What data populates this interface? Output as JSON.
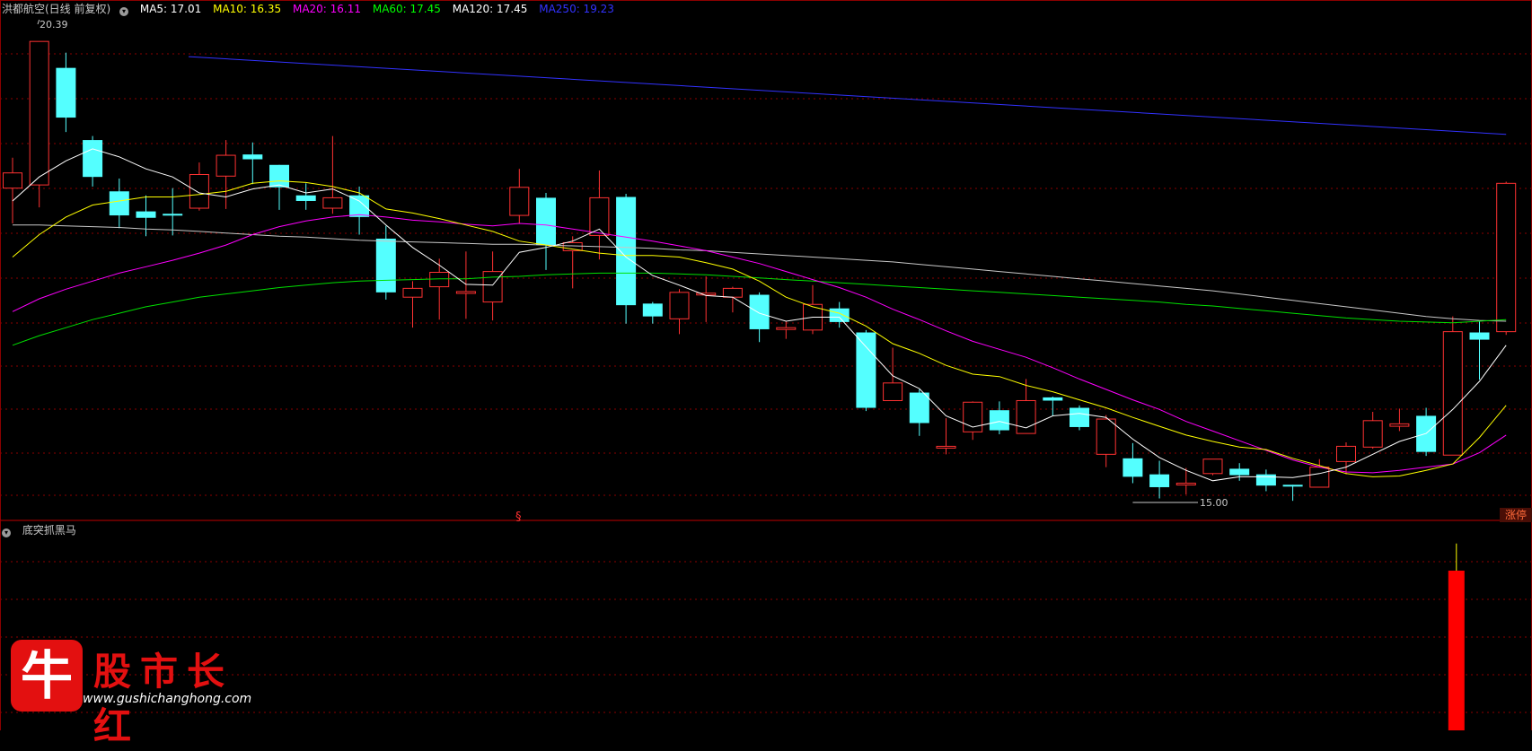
{
  "header": {
    "stock_name": "洪都航空(日线 前复权)",
    "indicators": [
      {
        "label": "MA5: 17.01",
        "color": "#ffffff"
      },
      {
        "label": "MA10: 16.35",
        "color": "#ffff00"
      },
      {
        "label": "MA20: 16.11",
        "color": "#ff00ff"
      },
      {
        "label": "MA60: 17.45",
        "color": "#00ff00"
      },
      {
        "label": "MA120: 17.45",
        "color": "#ffffff"
      },
      {
        "label": "MA250: 19.23",
        "color": "#3232ff"
      }
    ]
  },
  "annotations": {
    "high_label": "20.39",
    "low_label": "15.00",
    "section_mark": "§",
    "zt_label": "涨停"
  },
  "sub_panel": {
    "title": "底突抓黑马"
  },
  "logo": {
    "char": "牛",
    "title": "股市长红",
    "url": "www.gushichanghong.com"
  },
  "colors": {
    "up": "#ff3232",
    "down": "#54ffff",
    "grid": "#8b0000",
    "bar": "#ff0000"
  },
  "chart_data": {
    "type": "candlestick",
    "ohlc": [
      [
        18.56,
        18.75,
        18.12,
        18.94
      ],
      [
        18.6,
        20.39,
        18.32,
        20.39
      ],
      [
        20.06,
        19.44,
        19.26,
        20.25
      ],
      [
        19.16,
        18.7,
        18.58,
        19.21
      ],
      [
        18.52,
        18.22,
        18.06,
        18.68
      ],
      [
        18.27,
        18.19,
        17.96,
        18.47
      ],
      [
        18.24,
        18.22,
        17.97,
        18.56
      ],
      [
        18.31,
        18.73,
        18.28,
        18.88
      ],
      [
        18.71,
        18.97,
        18.3,
        19.16
      ],
      [
        18.98,
        18.92,
        18.61,
        19.13
      ],
      [
        18.85,
        18.57,
        18.29,
        18.84
      ],
      [
        18.47,
        18.4,
        18.29,
        18.62
      ],
      [
        18.31,
        18.44,
        18.24,
        19.21
      ],
      [
        18.47,
        18.2,
        17.98,
        18.58
      ],
      [
        17.93,
        17.26,
        17.17,
        18.09
      ],
      [
        17.2,
        17.31,
        16.82,
        17.4
      ],
      [
        17.33,
        17.51,
        16.92,
        17.68
      ],
      [
        17.26,
        17.27,
        16.93,
        17.77
      ],
      [
        17.14,
        17.52,
        16.91,
        17.77
      ],
      [
        18.22,
        18.57,
        18.12,
        18.8
      ],
      [
        18.44,
        17.85,
        17.54,
        18.5
      ],
      [
        17.78,
        17.88,
        17.31,
        17.96
      ],
      [
        17.97,
        18.44,
        17.67,
        18.78
      ],
      [
        18.45,
        17.1,
        16.87,
        18.49
      ],
      [
        17.12,
        16.96,
        16.87,
        17.14
      ],
      [
        16.93,
        17.26,
        16.74,
        17.3
      ],
      [
        17.24,
        17.25,
        16.89,
        17.46
      ],
      [
        17.2,
        17.31,
        17.01,
        17.33
      ],
      [
        17.23,
        16.8,
        16.64,
        17.26
      ],
      [
        16.82,
        16.82,
        16.68,
        16.9
      ],
      [
        16.79,
        17.11,
        16.74,
        17.35
      ],
      [
        17.06,
        16.89,
        16.82,
        17.14
      ],
      [
        16.76,
        15.82,
        15.78,
        16.79
      ],
      [
        15.91,
        16.13,
        15.95,
        16.57
      ],
      [
        16.01,
        15.63,
        15.47,
        16.05
      ],
      [
        15.34,
        15.34,
        15.24,
        15.69
      ],
      [
        15.52,
        15.89,
        15.42,
        15.9
      ],
      [
        15.79,
        15.54,
        15.49,
        15.9
      ],
      [
        15.5,
        15.91,
        15.51,
        16.18
      ],
      [
        15.95,
        15.91,
        15.72,
        15.96
      ],
      [
        15.82,
        15.58,
        15.54,
        15.85
      ],
      [
        15.24,
        15.68,
        15.08,
        15.73
      ],
      [
        15.19,
        14.96,
        14.88,
        15.38
      ],
      [
        14.99,
        14.83,
        14.69,
        15.16
      ],
      [
        14.88,
        14.88,
        14.74,
        15.07
      ],
      [
        15.0,
        15.18,
        14.98,
        15.0
      ],
      [
        15.06,
        14.98,
        14.91,
        15.13
      ],
      [
        14.99,
        14.85,
        14.78,
        15.05
      ],
      [
        14.86,
        14.85,
        14.66,
        14.86
      ],
      [
        14.83,
        15.08,
        14.83,
        15.18
      ],
      [
        15.15,
        15.34,
        14.99,
        15.39
      ],
      [
        15.33,
        15.66,
        15.31,
        15.77
      ],
      [
        15.59,
        15.62,
        15.53,
        15.81
      ],
      [
        15.72,
        15.27,
        15.22,
        15.82
      ],
      [
        15.23,
        16.77,
        16.88,
        16.96
      ],
      [
        16.76,
        16.67,
        16.17,
        16.9
      ],
      [
        16.77,
        18.62,
        16.73,
        18.64
      ]
    ],
    "ma5": [
      18.4,
      18.7,
      18.9,
      19.05,
      18.95,
      18.8,
      18.7,
      18.5,
      18.45,
      18.55,
      18.6,
      18.5,
      18.55,
      18.4,
      18.1,
      17.82,
      17.6,
      17.36,
      17.35,
      17.76,
      17.82,
      17.9,
      18.05,
      17.7,
      17.47,
      17.35,
      17.22,
      17.2,
      17.0,
      16.9,
      16.95,
      16.95,
      16.58,
      16.22,
      16.06,
      15.72,
      15.58,
      15.65,
      15.57,
      15.72,
      15.75,
      15.7,
      15.43,
      15.2,
      15.04,
      14.91,
      14.96,
      14.96,
      14.95,
      15.0,
      15.08,
      15.24,
      15.4,
      15.5,
      15.8,
      16.15,
      16.6
    ],
    "ma10": [
      17.7,
      17.98,
      18.2,
      18.35,
      18.4,
      18.45,
      18.45,
      18.48,
      18.52,
      18.62,
      18.65,
      18.63,
      18.58,
      18.5,
      18.3,
      18.25,
      18.18,
      18.1,
      18.02,
      17.9,
      17.85,
      17.8,
      17.75,
      17.72,
      17.72,
      17.7,
      17.63,
      17.55,
      17.4,
      17.2,
      17.08,
      17.0,
      16.84,
      16.62,
      16.5,
      16.35,
      16.24,
      16.21,
      16.1,
      16.02,
      15.92,
      15.82,
      15.7,
      15.59,
      15.48,
      15.4,
      15.33,
      15.3,
      15.19,
      15.1,
      15.0,
      14.96,
      14.97,
      15.04,
      15.12,
      15.45,
      15.85
    ],
    "ma20": [
      17.02,
      17.18,
      17.3,
      17.4,
      17.5,
      17.58,
      17.66,
      17.75,
      17.85,
      17.98,
      18.08,
      18.15,
      18.2,
      18.23,
      18.2,
      18.16,
      18.14,
      18.11,
      18.09,
      18.12,
      18.1,
      18.05,
      18.0,
      17.95,
      17.9,
      17.84,
      17.78,
      17.7,
      17.62,
      17.52,
      17.42,
      17.32,
      17.2,
      17.05,
      16.92,
      16.78,
      16.65,
      16.55,
      16.45,
      16.32,
      16.18,
      16.05,
      15.92,
      15.8,
      15.65,
      15.53,
      15.41,
      15.29,
      15.17,
      15.08,
      15.02,
      15.01,
      15.04,
      15.08,
      15.12,
      15.26,
      15.48
    ],
    "ma60": [
      16.6,
      16.72,
      16.82,
      16.92,
      17.0,
      17.08,
      17.14,
      17.2,
      17.24,
      17.28,
      17.32,
      17.35,
      17.38,
      17.4,
      17.41,
      17.42,
      17.43,
      17.43,
      17.45,
      17.46,
      17.48,
      17.49,
      17.5,
      17.5,
      17.5,
      17.49,
      17.48,
      17.46,
      17.44,
      17.42,
      17.4,
      17.38,
      17.36,
      17.34,
      17.32,
      17.3,
      17.28,
      17.26,
      17.24,
      17.22,
      17.2,
      17.18,
      17.16,
      17.14,
      17.11,
      17.09,
      17.06,
      17.03,
      17.0,
      16.97,
      16.94,
      16.92,
      16.9,
      16.89,
      16.88,
      16.9,
      16.92
    ],
    "ma120": [
      18.1,
      18.1,
      18.09,
      18.08,
      18.07,
      18.05,
      18.04,
      18.02,
      18.0,
      17.98,
      17.96,
      17.95,
      17.93,
      17.91,
      17.9,
      17.89,
      17.88,
      17.87,
      17.86,
      17.86,
      17.85,
      17.84,
      17.83,
      17.82,
      17.81,
      17.79,
      17.78,
      17.76,
      17.74,
      17.72,
      17.7,
      17.68,
      17.66,
      17.64,
      17.61,
      17.58,
      17.55,
      17.52,
      17.49,
      17.46,
      17.43,
      17.4,
      17.37,
      17.34,
      17.31,
      17.28,
      17.24,
      17.2,
      17.16,
      17.12,
      17.08,
      17.04,
      17.0,
      16.96,
      16.93,
      16.91,
      16.9
    ],
    "ma250": [
      20.2,
      19.23
    ],
    "price_range": [
      14.55,
      20.75
    ],
    "sub_signal": {
      "index": 54,
      "value": 1.0,
      "wick_top": 1.17
    },
    "grid": true
  }
}
